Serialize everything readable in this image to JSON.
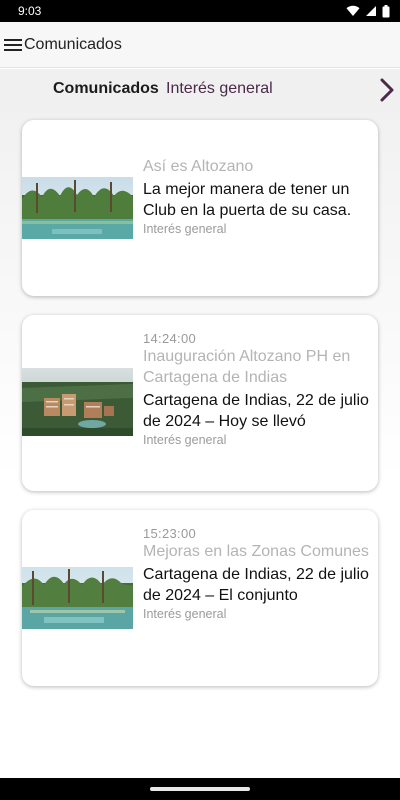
{
  "status_bar": {
    "time": "9:03"
  },
  "app_bar": {
    "title": "Comunicados"
  },
  "tabs": [
    {
      "label": "Comunicados"
    },
    {
      "label": "Interés general"
    }
  ],
  "cards": [
    {
      "time": "",
      "title": "Así es Altozano",
      "description": "La mejor manera de tener un Club en la puerta de su casa.",
      "category": "Interés general"
    },
    {
      "time": "14:24:00",
      "title": "Inauguración Altozano PH en Cartagena de Indias",
      "description": "Cartagena de Indias, 22 de julio de 2024 – Hoy se llevó",
      "category": "Interés general"
    },
    {
      "time": "15:23:00",
      "title": "Mejoras en las Zonas Comunes",
      "description": "Cartagena de Indias, 22 de julio de 2024 – El conjunto",
      "category": "Interés general"
    }
  ],
  "colors": {
    "accent": "#4a2a48",
    "title_muted": "#b4b4b4"
  }
}
